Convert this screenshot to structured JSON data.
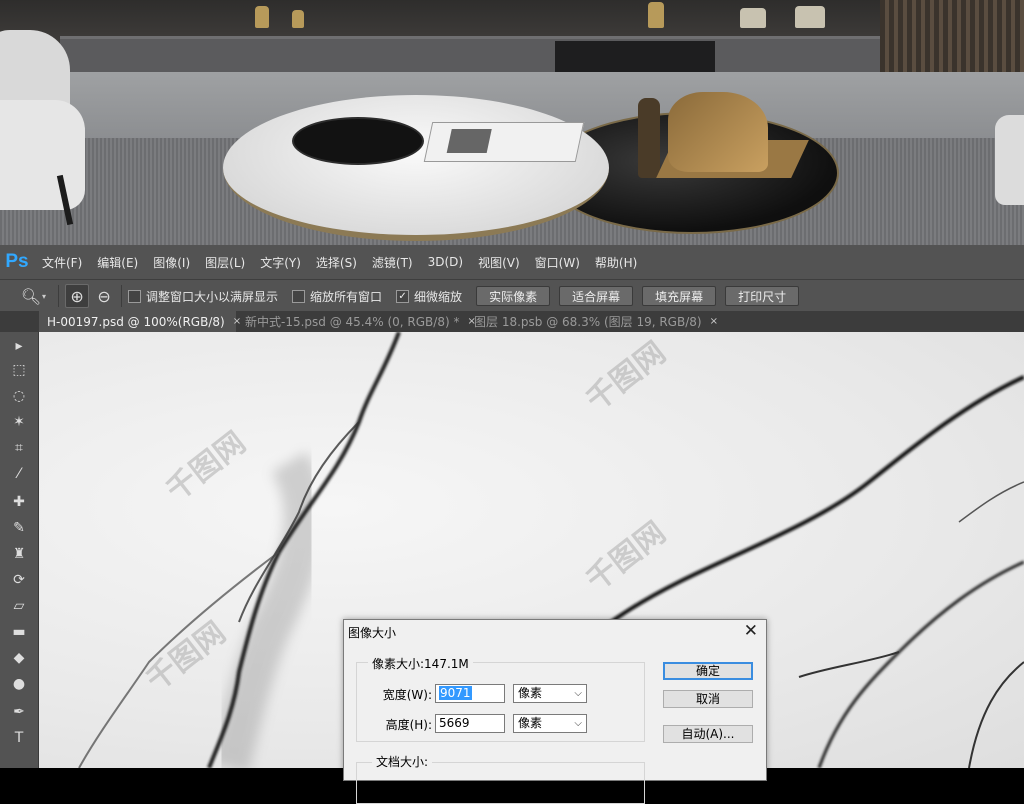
{
  "app": {
    "logo": "Ps"
  },
  "menu": [
    "文件(F)",
    "编辑(E)",
    "图像(I)",
    "图层(L)",
    "文字(Y)",
    "选择(S)",
    "滤镜(T)",
    "3D(D)",
    "视图(V)",
    "窗口(W)",
    "帮助(H)"
  ],
  "options": {
    "zoom_icon": "magnifier-icon",
    "zoom_in_icon": "zoom-in-icon",
    "zoom_out_icon": "zoom-out-icon",
    "checkbox_resize": {
      "label": "调整窗口大小以满屏显示",
      "checked": false
    },
    "checkbox_all": {
      "label": "缩放所有窗口",
      "checked": false
    },
    "checkbox_scrubby": {
      "label": "细微缩放",
      "checked": true
    },
    "btn_actual": "实际像素",
    "btn_fit": "适合屏幕",
    "btn_fill": "填充屏幕",
    "btn_print": "打印尺寸"
  },
  "tabs": [
    {
      "label": "H-00197.psd @ 100%(RGB/8)",
      "close": "×"
    },
    {
      "label": "新中式-15.psd @ 45.4% (0, RGB/8) *",
      "close": "×"
    },
    {
      "label": "图层 18.psb @ 68.3% (图层 19, RGB/8)",
      "close": "×"
    }
  ],
  "panel_collapse": "▸▸",
  "tools": [
    "move-tool-icon",
    "marquee-tool-icon",
    "lasso-tool-icon",
    "magic-wand-icon",
    "crop-tool-icon",
    "eyedropper-icon",
    "healing-brush-icon",
    "brush-tool-icon",
    "clone-stamp-icon",
    "history-brush-icon",
    "eraser-icon",
    "gradient-tool-icon",
    "blur-tool-icon",
    "dodge-tool-icon",
    "pen-tool-icon",
    "type-tool-icon"
  ],
  "tool_glyphs": [
    "▸",
    "⬚",
    "◌",
    "✶",
    "⌗",
    "⁄",
    "✚",
    "✎",
    "♜",
    "⟳",
    "▱",
    "▬",
    "◆",
    "●",
    "✒",
    "T"
  ],
  "dialog": {
    "title": "图像大小",
    "close": "✕",
    "pixel_group": "像素大小:147.1M",
    "width_label": "宽度(W):",
    "width_value": "9071",
    "width_unit": "像素",
    "height_label": "高度(H):",
    "height_value": "5669",
    "height_unit": "像素",
    "doc_group": "文档大小:",
    "ok": "确定",
    "cancel": "取消",
    "auto": "自动(A)..."
  },
  "colors": {
    "ps_accent": "#31a8ff",
    "panel": "#535353",
    "selection": "#3399ff"
  }
}
